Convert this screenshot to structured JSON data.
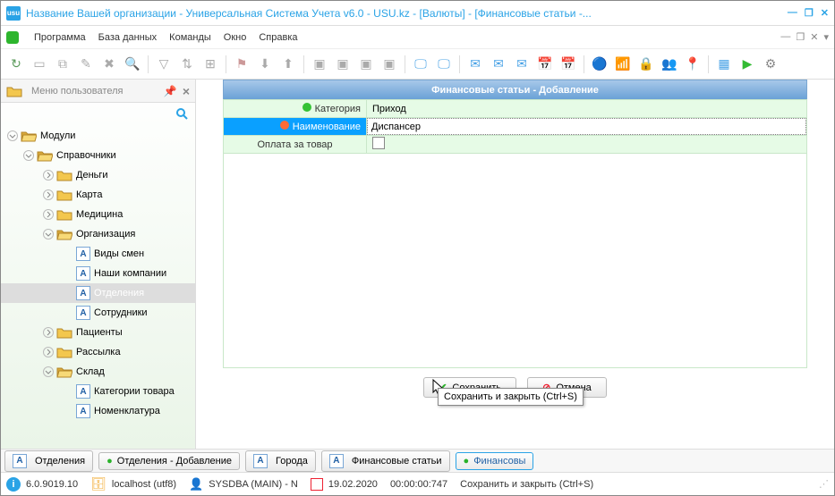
{
  "window": {
    "title": "Название Вашей организации - Универсальная Система Учета v6.0 - USU.kz - [Валюты] - [Финансовые статьи -..."
  },
  "menu": {
    "program": "Программа",
    "database": "База данных",
    "commands": "Команды",
    "window": "Окно",
    "help": "Справка"
  },
  "sidebar": {
    "header": "Меню пользователя",
    "items": {
      "modules": "Модули",
      "refs": "Справочники",
      "money": "Деньги",
      "card": "Карта",
      "medicine": "Медицина",
      "org": "Организация",
      "shifts": "Виды смен",
      "companies": "Наши компании",
      "departments": "Отделения",
      "employees": "Сотрудники",
      "patients": "Пациенты",
      "mailing": "Рассылка",
      "warehouse": "Склад",
      "cat_goods": "Категории товара",
      "nomenclature": "Номенклатура"
    }
  },
  "form": {
    "header": "Финансовые статьи - Добавление",
    "row1_label": "Категория",
    "row1_value": "Приход",
    "row2_label": "Наименование",
    "row2_value": "Диспансер",
    "row3_label": "Оплата за товар"
  },
  "buttons": {
    "save": "Сохранить",
    "cancel": "Отмена",
    "tooltip": "Сохранить и закрыть (Ctrl+S)"
  },
  "tabs": {
    "t1": "Отделения",
    "t2": "Отделения - Добавление",
    "t3": "Города",
    "t4": "Финансовые статьи",
    "t5": "Финансовы"
  },
  "status": {
    "version": "6.0.9019.10",
    "host": "localhost (utf8)",
    "user": "SYSDBA (MAIN) - N",
    "date": "19.02.2020",
    "time": "00:00:00:747",
    "hint": "Сохранить и закрыть (Ctrl+S)"
  },
  "chart_data": null
}
